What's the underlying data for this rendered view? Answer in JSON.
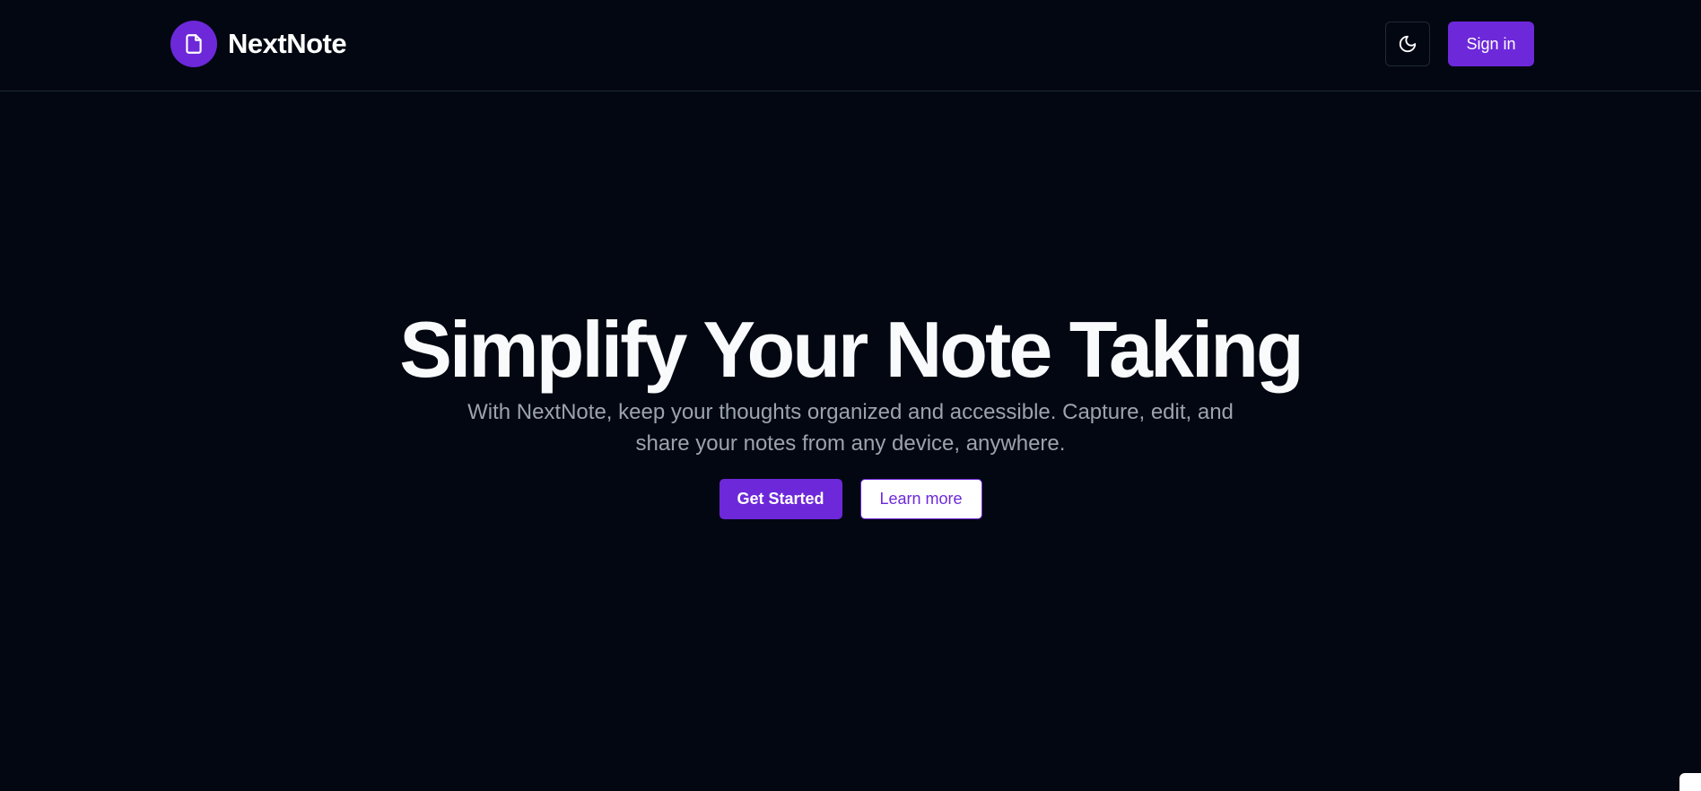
{
  "header": {
    "brand": "NextNote",
    "logo_icon": "document-icon",
    "theme_icon": "moon-icon",
    "signin_label": "Sign in"
  },
  "hero": {
    "title": "Simplify Your Note Taking",
    "subtitle": "With NextNote, keep your thoughts organized and accessible. Capture, edit, and share your notes from any device, anywhere.",
    "primary_label": "Get Started",
    "secondary_label": "Learn more"
  },
  "colors": {
    "background": "#030712",
    "accent": "#6d28d9",
    "muted_text": "#9ca3af",
    "border": "#1f2937"
  }
}
